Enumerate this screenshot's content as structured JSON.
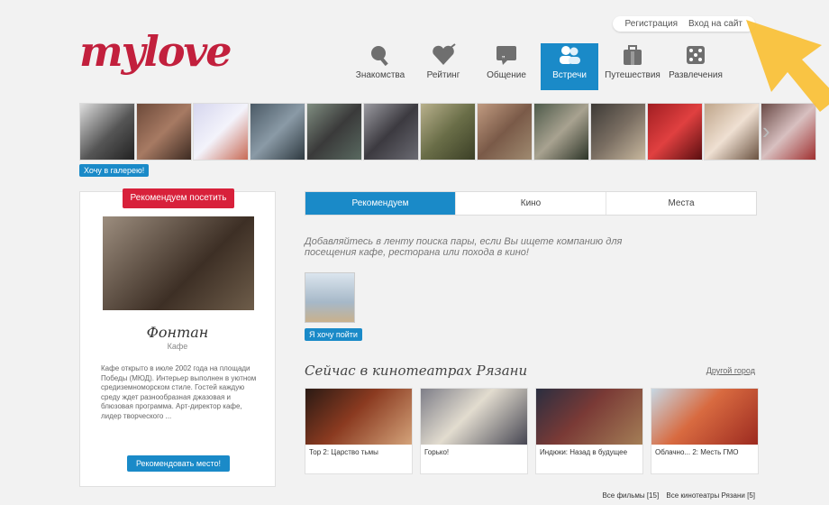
{
  "topbar": {
    "register": "Регистрация",
    "login": "Вход на сайт"
  },
  "brand": {
    "logo": "mylove"
  },
  "nav": {
    "items": [
      {
        "label": "Знакомства",
        "icon": "search-heart-icon"
      },
      {
        "label": "Рейтинг",
        "icon": "heart-arrow-icon"
      },
      {
        "label": "Общение",
        "icon": "chat-icon"
      },
      {
        "label": "Встречи",
        "icon": "people-icon"
      },
      {
        "label": "Путешествия",
        "icon": "suitcase-icon"
      },
      {
        "label": "Развлечения",
        "icon": "dice-icon"
      }
    ],
    "active_index": 3
  },
  "gallery": {
    "button": "Хочу в галерею!"
  },
  "venue": {
    "badge": "Рекомендуем посетить",
    "title": "Фонтан",
    "type": "Кафе",
    "desc": "Кафе открыто в июле 2002 года на площади Победы (МЮД). Интерьер выполнен в уютном средиземноморском стиле. Гостей каждую среду ждет разнообразная джазовая и блюзовая программа. Арт-директор кафе, лидер творческого ...",
    "button": "Рекомендовать место!"
  },
  "tabs": [
    "Рекомендуем",
    "Кино",
    "Места"
  ],
  "intro": "Добавляйтесь в ленту поиска пары, если Вы ищете компанию для посещения кафе, ресторана или похода в кино!",
  "want_button": "Я хочу пойти",
  "section": {
    "title": "Сейчас в кинотеатрах Рязани",
    "other_city": "Другой город"
  },
  "movies": [
    {
      "title": "Тор 2: Царство тьмы"
    },
    {
      "title": "Горько!"
    },
    {
      "title": "Индюки: Назад в будущее"
    },
    {
      "title": "Облачно... 2: Месть ГМО"
    }
  ],
  "footer": {
    "all_movies": "Все фильмы [15]",
    "all_cinemas": "Все кинотеатры Рязани [5]"
  }
}
